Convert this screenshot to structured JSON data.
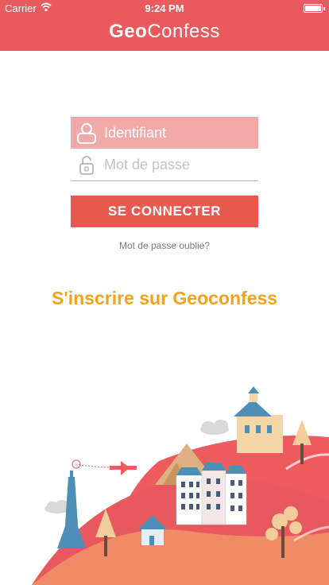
{
  "status_bar": {
    "carrier": "Carrier",
    "time": "9:24 PM"
  },
  "navbar": {
    "title_part1": "Geo",
    "title_part2": "Confess"
  },
  "login": {
    "username_placeholder": "Identifiant",
    "password_placeholder": "Mot de passe",
    "submit_label": "SE CONNECTER",
    "forgot_label": "Mot de passe oublie?"
  },
  "signup": {
    "label": "S'inscrire sur Geoconfess"
  },
  "colors": {
    "primary": "#e85a5e",
    "button": "#e85a50",
    "field_active": "#f2aaa9",
    "signup_text": "#f2a21b"
  },
  "icons": [
    "wifi-icon",
    "battery-icon",
    "user-icon",
    "padlock-icon"
  ]
}
